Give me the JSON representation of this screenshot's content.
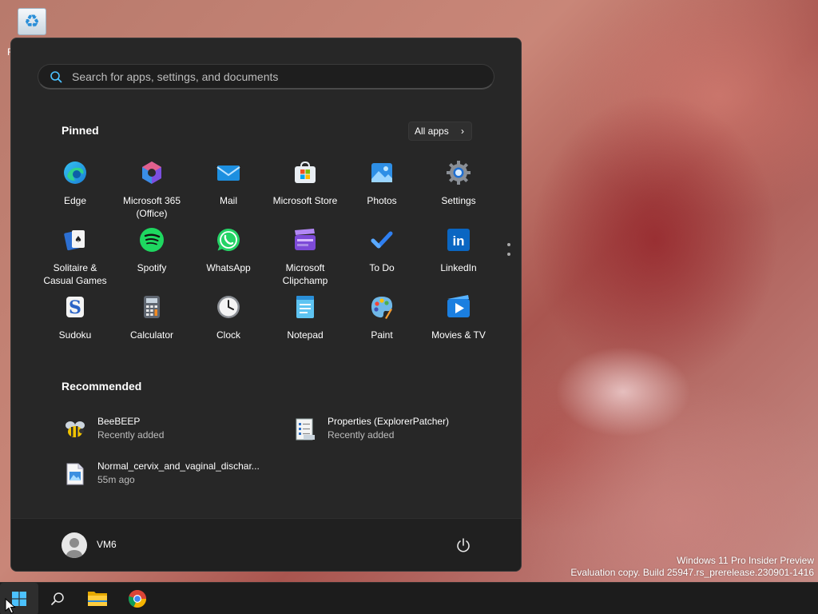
{
  "desktop": {
    "recycle_bin_label": "R"
  },
  "search": {
    "placeholder": "Search for apps, settings, and documents"
  },
  "pinned": {
    "title": "Pinned",
    "all_apps_label": "All apps",
    "apps": [
      {
        "label": "Edge",
        "icon": "edge-icon"
      },
      {
        "label": "Microsoft 365\n(Office)",
        "icon": "microsoft-365-icon"
      },
      {
        "label": "Mail",
        "icon": "mail-icon"
      },
      {
        "label": "Microsoft Store",
        "icon": "store-icon"
      },
      {
        "label": "Photos",
        "icon": "photos-icon"
      },
      {
        "label": "Settings",
        "icon": "settings-gear-icon"
      },
      {
        "label": "Solitaire &\nCasual Games",
        "icon": "solitaire-icon"
      },
      {
        "label": "Spotify",
        "icon": "spotify-icon"
      },
      {
        "label": "WhatsApp",
        "icon": "whatsapp-icon"
      },
      {
        "label": "Microsoft\nClipchamp",
        "icon": "clipchamp-icon"
      },
      {
        "label": "To Do",
        "icon": "todo-icon"
      },
      {
        "label": "LinkedIn",
        "icon": "linkedin-icon"
      },
      {
        "label": "Sudoku",
        "icon": "sudoku-icon"
      },
      {
        "label": "Calculator",
        "icon": "calculator-icon"
      },
      {
        "label": "Clock",
        "icon": "clock-icon"
      },
      {
        "label": "Notepad",
        "icon": "notepad-icon"
      },
      {
        "label": "Paint",
        "icon": "paint-icon"
      },
      {
        "label": "Movies & TV",
        "icon": "movies-tv-icon"
      }
    ]
  },
  "recommended": {
    "title": "Recommended",
    "items": [
      {
        "name": "BeeBEEP",
        "detail": "Recently added",
        "icon": "bee-icon"
      },
      {
        "name": "Properties (ExplorerPatcher)",
        "detail": "Recently added",
        "icon": "properties-icon"
      },
      {
        "name": "Normal_cervix_and_vaginal_dischar...",
        "detail": "55m ago",
        "icon": "image-file-icon"
      }
    ]
  },
  "user": {
    "name": "VM6"
  },
  "watermark": {
    "line1": "Windows 11 Pro Insider Preview",
    "line2": "Evaluation copy. Build 25947.rs_prerelease.230901-1416"
  },
  "taskbar": {
    "items": [
      "start-icon",
      "search-icon",
      "file-explorer-icon",
      "chrome-icon"
    ]
  },
  "colors": {
    "menu_bg": "#272727",
    "accent": "#4cc2ff",
    "taskbar_bg": "#1c1c1c"
  }
}
